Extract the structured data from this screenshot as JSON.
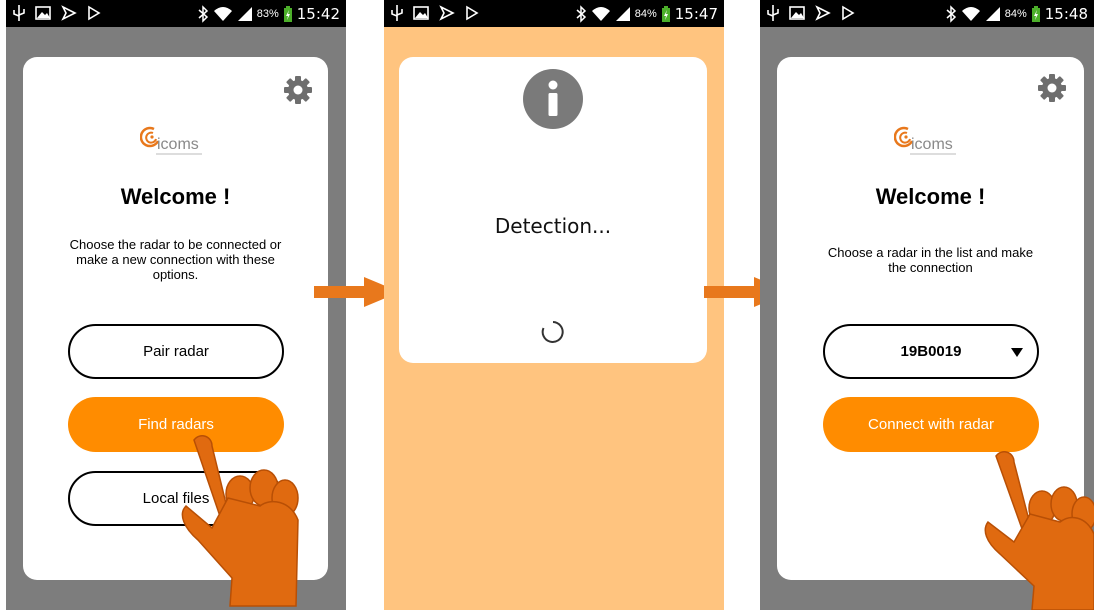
{
  "screen1": {
    "status": {
      "battery_pct": "83%",
      "time": "15:42"
    },
    "logo_text": "icoms",
    "title": "Welcome !",
    "instructions": [
      "Choose the radar to be connected or",
      "make a new connection with these",
      "options."
    ],
    "buttons": {
      "pair": "Pair radar",
      "find": "Find radars",
      "local": "Local files"
    }
  },
  "screen2": {
    "status": {
      "battery_pct": "84%",
      "time": "15:47"
    },
    "dialog_text": "Detection..."
  },
  "screen3": {
    "status": {
      "battery_pct": "84%",
      "time": "15:48"
    },
    "logo_text": "icoms",
    "title": "Welcome !",
    "instructions": [
      "Choose a radar in the list and make",
      "the connection"
    ],
    "select_value": "19B0019",
    "connect_button": "Connect with radar"
  },
  "colors": {
    "accent": "#ff8c00",
    "hand": "#e06a10",
    "arrow": "#e8781c",
    "peach": "#ffc47f",
    "grey": "#7d7d7d"
  },
  "icons": [
    "usb-icon",
    "image-icon",
    "cast-icon",
    "play-icon",
    "bluetooth-icon",
    "wifi-icon",
    "signal-icon",
    "battery-icon",
    "gear-icon",
    "info-icon",
    "spinner-icon",
    "dropdown-arrow-icon",
    "pointing-hand-icon",
    "arrow-right-icon"
  ]
}
